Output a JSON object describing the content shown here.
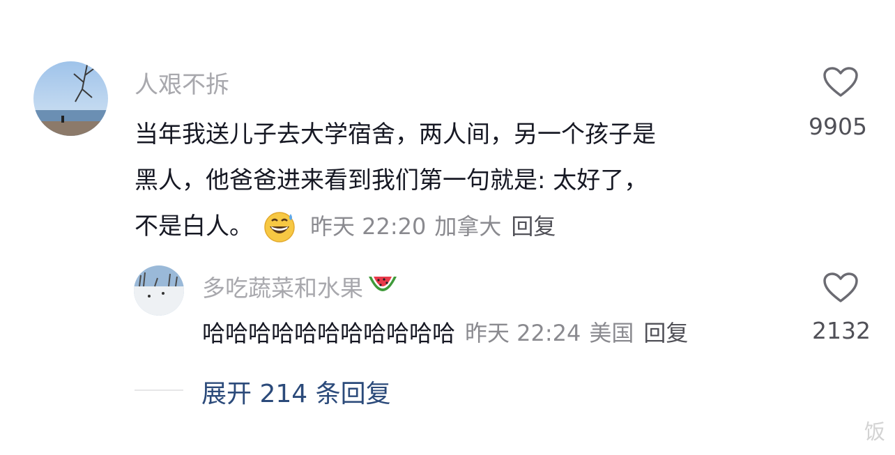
{
  "comment": {
    "username": "人艰不拆",
    "text_lines": [
      "当年我送儿子去大学宿舍，两人间，另一个孩子是",
      "黑人，他爸爸进来看到我们第一句就是: 太好了，",
      "不是白人。"
    ],
    "emoji": "grinning-sweat-emoji",
    "time": "昨天 22:20",
    "location": "加拿大",
    "reply_label": "回复",
    "like_count": "9905"
  },
  "reply": {
    "username": "多吃蔬菜和水果",
    "username_emoji": "watermelon-emoji",
    "text": "哈哈哈哈哈哈哈哈哈哈哈",
    "time": "昨天 22:24",
    "location": "美国",
    "reply_label": "回复",
    "like_count": "2132"
  },
  "expand": {
    "label": "展开 214 条回复"
  },
  "watermark": "饭",
  "colors": {
    "username": "#a8a8ad",
    "text": "#161823",
    "meta": "#8a8a8f",
    "expand": "#2b4a7a"
  }
}
